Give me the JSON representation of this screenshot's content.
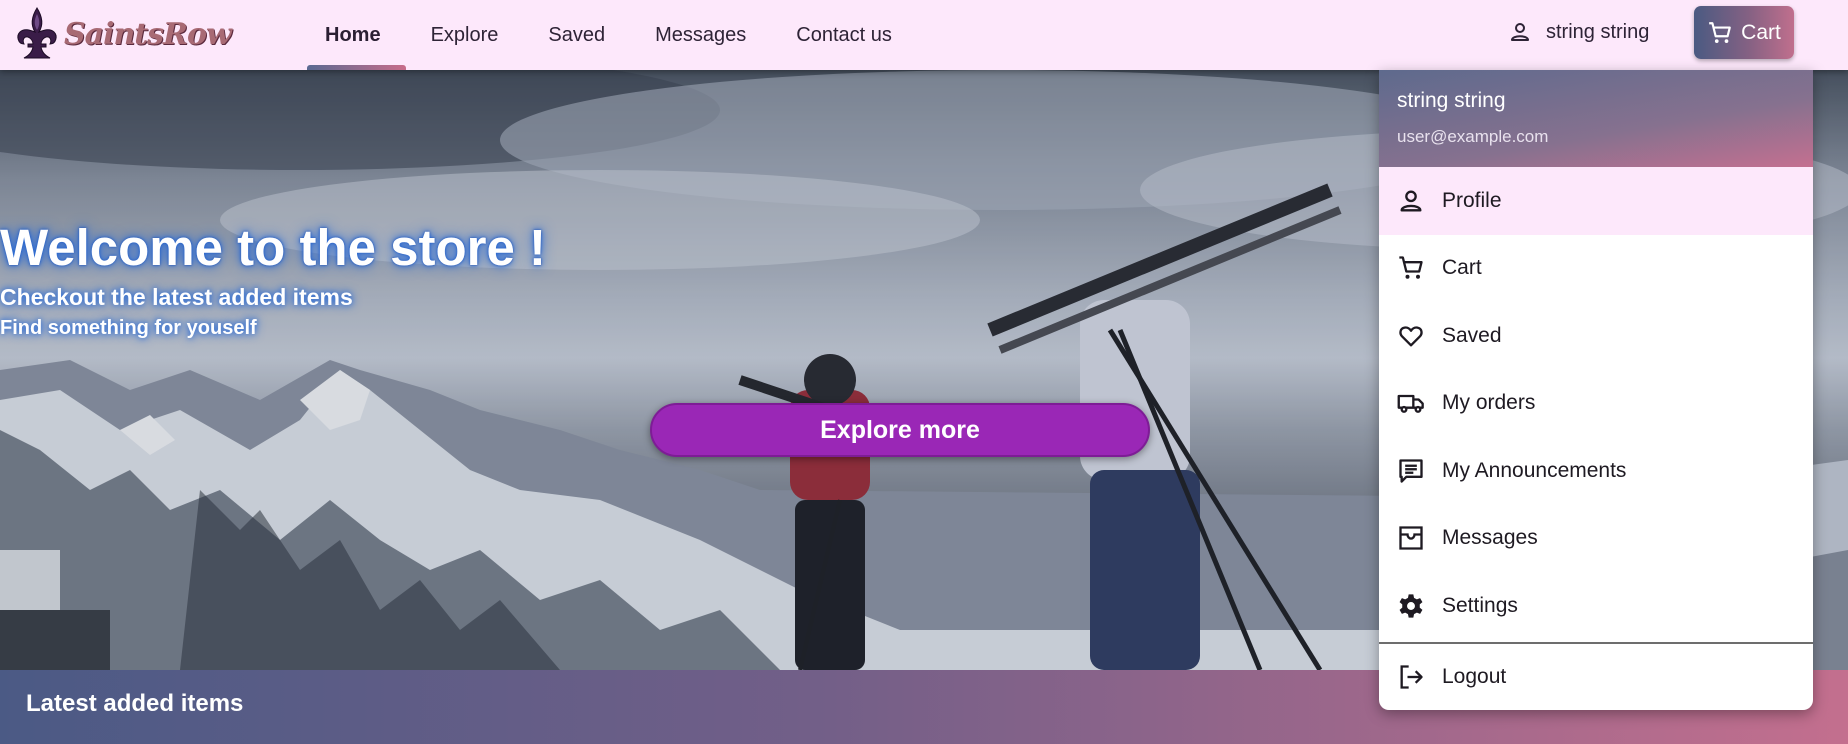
{
  "brand": {
    "logo_text": "SaintsRow"
  },
  "nav": {
    "items": [
      {
        "label": "Home",
        "active": true
      },
      {
        "label": "Explore",
        "active": false
      },
      {
        "label": "Saved",
        "active": false
      },
      {
        "label": "Messages",
        "active": false
      },
      {
        "label": "Contact us",
        "active": false
      }
    ]
  },
  "user": {
    "name": "string string",
    "email": "user@example.com"
  },
  "cart": {
    "label": "Cart"
  },
  "hero": {
    "title": "Welcome to the store !",
    "subtitle": "Checkout the latest added items",
    "tagline": "Find something for youself",
    "cta_label": "Explore more"
  },
  "latest": {
    "title": "Latest added items"
  },
  "user_menu": {
    "items": [
      {
        "label": "Profile",
        "icon": "person-icon"
      },
      {
        "label": "Cart",
        "icon": "cart-icon"
      },
      {
        "label": "Saved",
        "icon": "heart-icon"
      },
      {
        "label": "My orders",
        "icon": "truck-icon"
      },
      {
        "label": "My Announcements",
        "icon": "announcement-icon"
      },
      {
        "label": "Messages",
        "icon": "inbox-icon"
      },
      {
        "label": "Settings",
        "icon": "gear-icon"
      }
    ],
    "logout_label": "Logout"
  },
  "colors": {
    "header_bg": "#fde8fb",
    "cta": "#9a27b6",
    "gradient_start": "#4b5a85",
    "gradient_end": "#c36f8e"
  }
}
